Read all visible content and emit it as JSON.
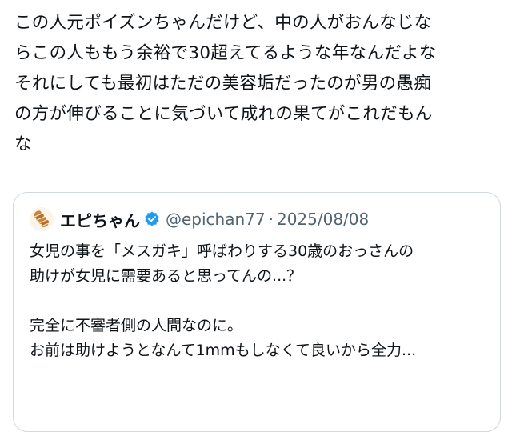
{
  "post": {
    "lines": [
      "この人元ポイズンちゃんだけど、中の人がおんなじな",
      "らこの人ももう余裕で30超えてるような年なんだよな",
      "それにしても最初はただの美容垢だったのが男の愚痴",
      "の方が伸びることに気づいて成れの果てがこれだもん",
      "な"
    ]
  },
  "quote": {
    "display_name": "エピちゃん",
    "handle": "@epichan77",
    "separator": "·",
    "date": "2025/08/08",
    "verified_color": "#1d9bf0",
    "lines": [
      "女児の事を「メスガキ」呼ばわりする30歳のおっさんの",
      "助けが女児に需要あると思ってんの...？",
      "",
      "完全に不審者側の人間なのに。",
      "お前は助けようとなんて1mmもしなくて良いから全力..."
    ]
  }
}
